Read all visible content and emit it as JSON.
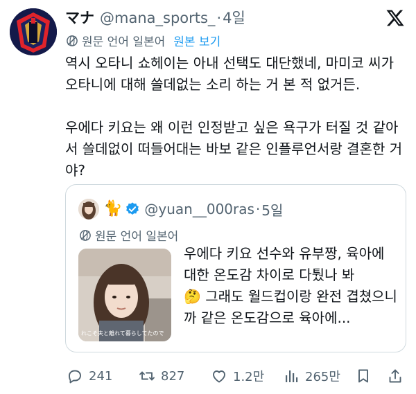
{
  "author": {
    "display_name": "マナ",
    "handle": "@mana_sports_",
    "separator": "·",
    "time": "4일"
  },
  "translation": {
    "label": "원문 언어 일본어",
    "show_original": "원본 보기"
  },
  "tweet_text": "역시 오타니 쇼헤이는 아내 선택도 대단했네, 마미코 씨가 오타니에 대해 쓸데없는 소리 하는 거 본 적 없거든.\n\n우에다 키요는 왜 이런 인정받고 싶은 욕구가 터질 것 같아서 쓸데없이 떠들어대는 바보 같은 인플루언서랑 결혼한 거야?",
  "quote": {
    "emoji": "🐈",
    "handle": "@yuan__000ras",
    "separator": "·",
    "time": "5일",
    "translation_label": "원문 언어 일본어",
    "media_caption": "れこそ夫と離れて暮らしてたので",
    "text": "우에다 키요 선수와 유부짱, 육아에 대한 온도감 차이로 다퉜나 봐\n🤔 그래도 월드컵이랑 완전 겹쳤으니까 같은 온도감으로 육아에..."
  },
  "actions": {
    "replies": "241",
    "retweets": "827",
    "likes": "1.2만",
    "views": "265만"
  },
  "icons": {
    "logo": "x-logo-icon",
    "translate": "globe-icon",
    "verified": "verified-badge-icon",
    "reply": "reply-icon",
    "retweet": "retweet-icon",
    "like": "heart-icon",
    "views": "views-icon",
    "bookmark": "bookmark-icon",
    "share": "share-icon"
  },
  "colors": {
    "link": "#1d9bf0",
    "secondary_text": "#536471",
    "primary_text": "#0f1419",
    "verified": "#1d9bf0",
    "border": "#cfd9de"
  }
}
